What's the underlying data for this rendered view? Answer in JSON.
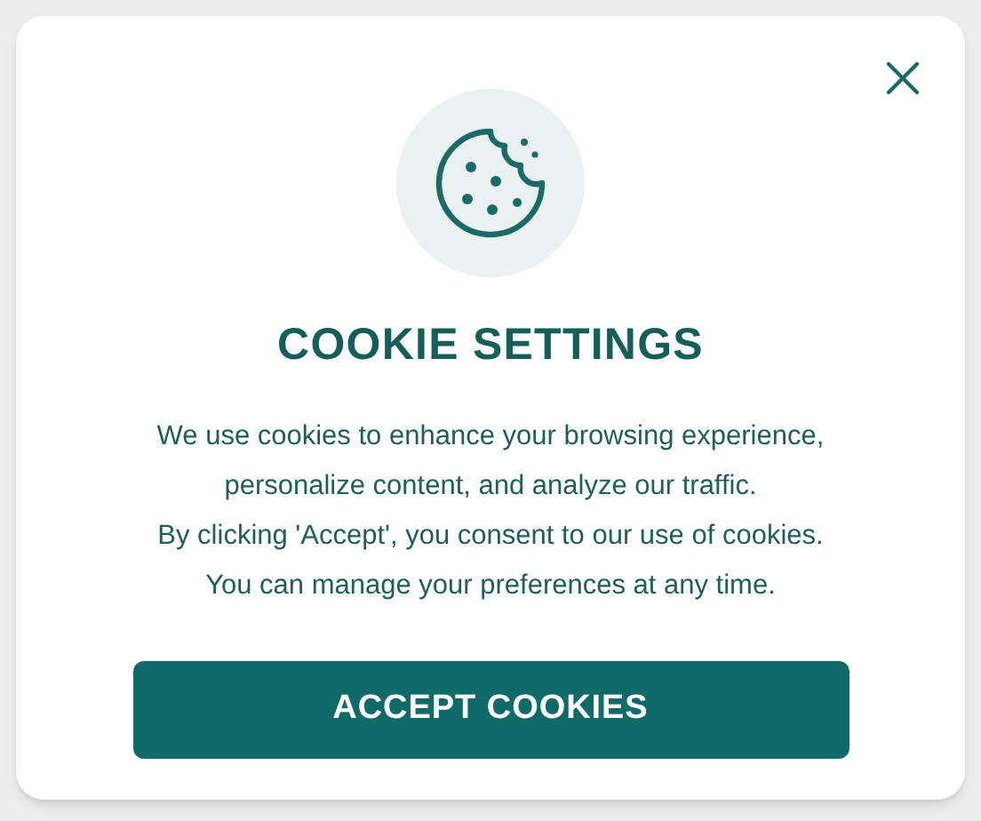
{
  "dialog": {
    "title": "COOKIE SETTINGS",
    "message_lines": [
      "We use cookies to enhance your browsing experience,",
      "personalize content, and analyze our traffic.",
      "By clicking 'Accept', you consent to our use of cookies.",
      "You can manage your preferences at any time."
    ],
    "button": "ACCEPT COOKIES"
  }
}
